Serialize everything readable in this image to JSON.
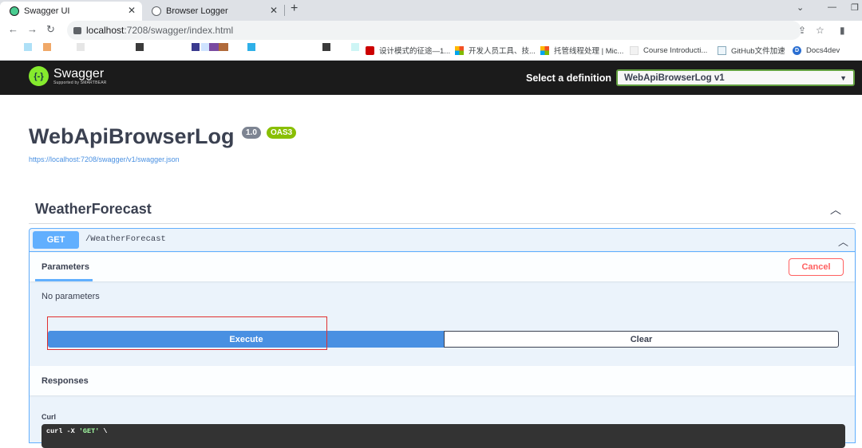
{
  "browser": {
    "tabs": [
      {
        "label": "Swagger UI",
        "active": true
      },
      {
        "label": "Browser Logger",
        "active": false
      }
    ],
    "url_host": "localhost",
    "url_rest": ":7208/swagger/index.html",
    "bookmarks": [
      "设计模式的征途—1...",
      "开发人员工具、技...",
      "托管线程处理 | Mic...",
      "Course Introducti...",
      "GitHub文件加速",
      "Docs4dev"
    ]
  },
  "topbar": {
    "logo_name": "Swagger",
    "logo_sub": "Supported by SMARTBEAR",
    "select_label": "Select a definition",
    "definition": "WebApiBrowserLog v1"
  },
  "info": {
    "title": "WebApiBrowserLog",
    "version": "1.0",
    "oas": "OAS3",
    "url": "https://localhost:7208/swagger/v1/swagger.json"
  },
  "tag": {
    "name": "WeatherForecast"
  },
  "operation": {
    "method": "GET",
    "path": "/WeatherForecast",
    "params_title": "Parameters",
    "cancel_label": "Cancel",
    "no_params": "No parameters",
    "execute_label": "Execute",
    "clear_label": "Clear",
    "responses_title": "Responses",
    "curl_label": "Curl",
    "curl_line1_cmd": "curl -X ",
    "curl_line1_str": "'GET'",
    "curl_line1_end": " \\"
  },
  "colors": {
    "get": "#61affe",
    "execute": "#4990e2",
    "cancel": "#ff6060",
    "topbar": "#1b1b1b",
    "select_border": "#62a03f"
  }
}
